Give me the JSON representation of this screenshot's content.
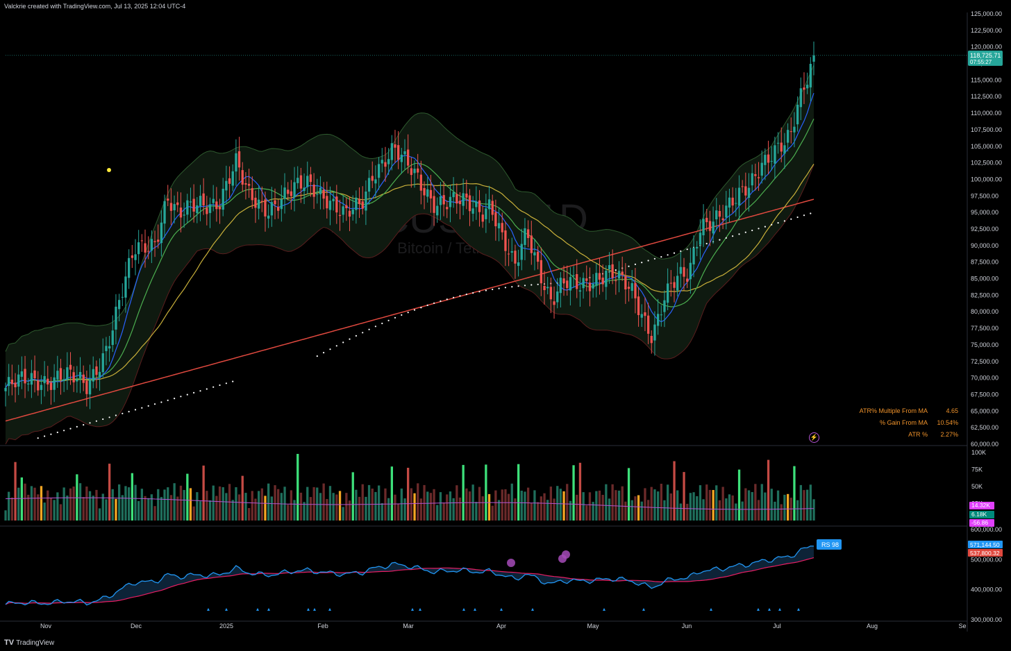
{
  "header": {
    "title": "Valckrie created with TradingView.com, Jul 13, 2025 12:04 UTC-4"
  },
  "watermark": {
    "symbol": "BTCUSDT, 1D",
    "description": "Bitcoin / TetherUS"
  },
  "footer": {
    "brand": "TradingView"
  },
  "price_badge": {
    "price": "118,725.71",
    "countdown": "07:55:27"
  },
  "volume_badges": [
    "14.32K",
    "6.18K",
    "-56.86"
  ],
  "rs_badges": {
    "rs": "RS 98",
    "v1": "571,144.50",
    "v2": "537,800.32"
  },
  "stats": [
    {
      "label": "ATR% Multiple From MA",
      "value": "4.65"
    },
    {
      "label": "% Gain From MA",
      "value": "10.54%"
    },
    {
      "label": "ATR %",
      "value": "2.27%"
    }
  ],
  "colors": {
    "background": "#000000",
    "up": "#26a69a",
    "down": "#ef5350",
    "ema_fast": "#2962ff",
    "ema_green": "#4caf50",
    "sma_yellow": "#c9b03a",
    "sma_red": "#e0493f",
    "dots": "#ffffff",
    "rs_line": "#2196f3",
    "rs_ma": "#e91e63",
    "price_badge": "#26a69a",
    "rs_badge": "#2196f3",
    "stats_text": "#f0932b"
  },
  "chart_data": {
    "type": "candlestick",
    "symbol": "BTCUSDT",
    "timeframe": "1D",
    "xlabels": [
      "Nov",
      "Dec",
      "2025",
      "Feb",
      "Mar",
      "Apr",
      "May",
      "Jun",
      "Jul",
      "Aug",
      "Se"
    ],
    "price_axis": {
      "ticks": [
        "125,000.00",
        "122,500.00",
        "120,000.00",
        "117,500.00",
        "115,000.00",
        "112,500.00",
        "110,000.00",
        "107,500.00",
        "105,000.00",
        "102,500.00",
        "100,000.00",
        "97,500.00",
        "95,000.00",
        "92,500.00",
        "90,000.00",
        "87,500.00",
        "85,000.00",
        "82,500.00",
        "80,000.00",
        "77,500.00",
        "75,000.00",
        "72,500.00",
        "70,000.00",
        "67,500.00",
        "65,000.00",
        "62,500.00",
        "60,000.00"
      ],
      "range": [
        60000,
        125000
      ]
    },
    "volume_axis": {
      "ticks": [
        "100K",
        "75K",
        "50K",
        "25K"
      ],
      "range": [
        0,
        100000
      ]
    },
    "rs_axis": {
      "ticks": [
        "600,000.00",
        "500,000.00",
        "400,000.00",
        "300,000.00"
      ],
      "range": [
        300000,
        600000
      ]
    },
    "price_series": [
      {
        "t": 0,
        "c": 68500
      },
      {
        "t": 0.03,
        "c": 69500
      },
      {
        "t": 0.07,
        "c": 70500
      },
      {
        "t": 0.1,
        "c": 68500
      },
      {
        "t": 0.125,
        "c": 75000
      },
      {
        "t": 0.14,
        "c": 81000
      },
      {
        "t": 0.16,
        "c": 89000
      },
      {
        "t": 0.185,
        "c": 91000
      },
      {
        "t": 0.2,
        "c": 97500
      },
      {
        "t": 0.215,
        "c": 94000
      },
      {
        "t": 0.24,
        "c": 96500
      },
      {
        "t": 0.265,
        "c": 97000
      },
      {
        "t": 0.285,
        "c": 102000
      },
      {
        "t": 0.3,
        "c": 97500
      },
      {
        "t": 0.325,
        "c": 96000
      },
      {
        "t": 0.35,
        "c": 97500
      },
      {
        "t": 0.375,
        "c": 99500
      },
      {
        "t": 0.395,
        "c": 98000
      },
      {
        "t": 0.42,
        "c": 94000
      },
      {
        "t": 0.44,
        "c": 96000
      },
      {
        "t": 0.455,
        "c": 101500
      },
      {
        "t": 0.47,
        "c": 103500
      },
      {
        "t": 0.48,
        "c": 104500
      },
      {
        "t": 0.495,
        "c": 102000
      },
      {
        "t": 0.51,
        "c": 100000
      },
      {
        "t": 0.53,
        "c": 97000
      },
      {
        "t": 0.55,
        "c": 96500
      },
      {
        "t": 0.57,
        "c": 96000
      },
      {
        "t": 0.59,
        "c": 95500
      },
      {
        "t": 0.6,
        "c": 97000
      },
      {
        "t": 0.615,
        "c": 91000
      },
      {
        "t": 0.63,
        "c": 86000
      },
      {
        "t": 0.645,
        "c": 92000
      },
      {
        "t": 0.66,
        "c": 87000
      },
      {
        "t": 0.675,
        "c": 82000
      },
      {
        "t": 0.69,
        "c": 84000
      },
      {
        "t": 0.71,
        "c": 83500
      },
      {
        "t": 0.73,
        "c": 85500
      },
      {
        "t": 0.745,
        "c": 86500
      },
      {
        "t": 0.76,
        "c": 84500
      },
      {
        "t": 0.775,
        "c": 82500
      },
      {
        "t": 0.79,
        "c": 79000
      },
      {
        "t": 0.8,
        "c": 77000
      },
      {
        "t": 0.815,
        "c": 82500
      },
      {
        "t": 0.83,
        "c": 84500
      },
      {
        "t": 0.845,
        "c": 85000
      },
      {
        "t": 0.86,
        "c": 93500
      },
      {
        "t": 0.875,
        "c": 94500
      },
      {
        "t": 0.89,
        "c": 95000
      },
      {
        "t": 0.905,
        "c": 96500
      },
      {
        "t": 0.92,
        "c": 99000
      },
      {
        "t": 0.935,
        "c": 103000
      },
      {
        "t": 0.95,
        "c": 104500
      },
      {
        "t": 0.965,
        "c": 105000
      },
      {
        "t": 0.98,
        "c": 107500
      },
      {
        "t": 1,
        "c": 108500
      }
    ],
    "last_price": 118725.71,
    "rs_rating": 98,
    "rs_values": {
      "rs_line": 571144.5,
      "rs_ma": 537800.32
    },
    "volume_values": {
      "last": 14320,
      "average": 6180,
      "delta": -56.86
    }
  }
}
